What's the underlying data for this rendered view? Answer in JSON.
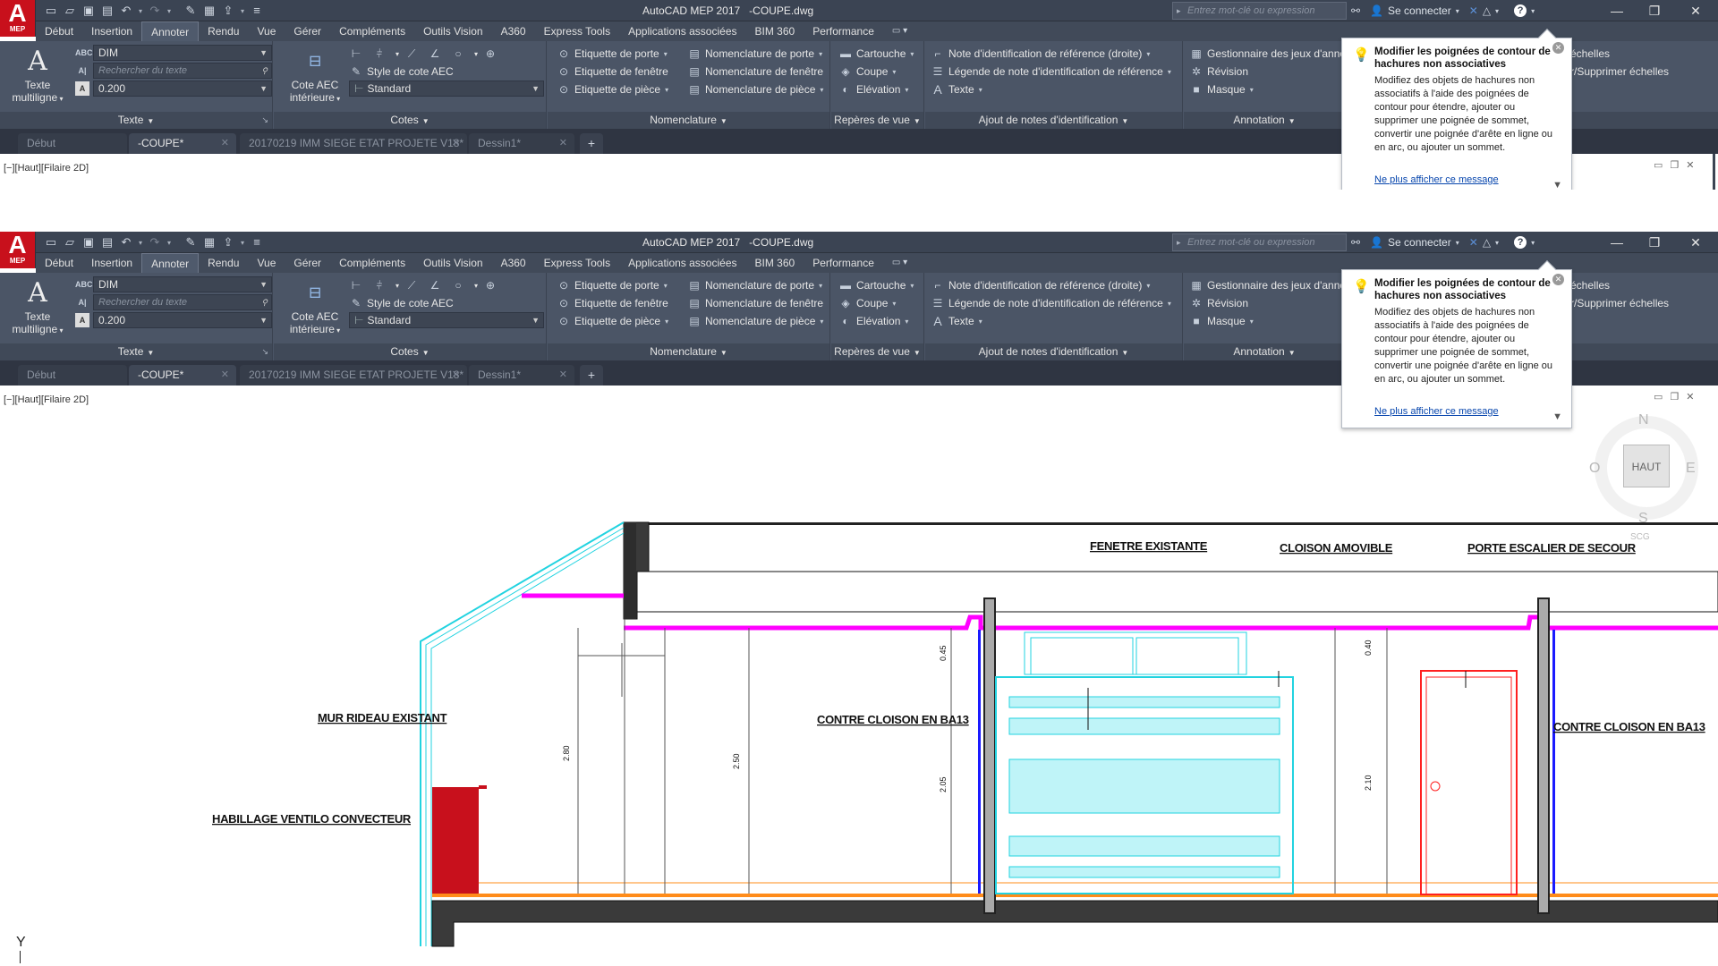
{
  "app": {
    "logo_letter": "A",
    "logo_sub": "MEP",
    "title": "AutoCAD MEP 2017   -COUPE.dwg",
    "search_placeholder": "Entrez mot-clé ou expression",
    "sign_in": "Se connecter"
  },
  "ribbon_tabs": [
    "Début",
    "Insertion",
    "Annoter",
    "Rendu",
    "Vue",
    "Gérer",
    "Compléments",
    "Outils Vision",
    "A360",
    "Express Tools",
    "Applications associées",
    "BIM 360",
    "Performance"
  ],
  "active_ribbon_tab": "Annoter",
  "panels": {
    "texte": {
      "title": "Texte",
      "big_button": [
        "Texte",
        "multiligne"
      ],
      "style_value": "DIM",
      "search_placeholder": "Rechercher du texte",
      "height_value": "0.200"
    },
    "cotes": {
      "title": "Cotes",
      "big_button": [
        "Cote AEC",
        "intérieure"
      ],
      "style_label": "Style de cote AEC",
      "style_value": "Standard"
    },
    "nomenclature": {
      "title": "Nomenclature",
      "items": [
        "Etiquette de porte",
        "Etiquette de fenêtre",
        "Etiquette de pièce",
        "Nomenclature de porte",
        "Nomenclature de fenêtre",
        "Nomenclature de pièce"
      ]
    },
    "reperes": {
      "title": "Repères de vue",
      "items": [
        "Cartouche",
        "Coupe",
        "Elévation"
      ]
    },
    "ajout_notes": {
      "title": "Ajout de notes d'identification",
      "items": [
        "Note d'identification de référence (droite)",
        "Légende de note d'identification de référence",
        "Texte"
      ]
    },
    "annotation": {
      "title": "Annotation",
      "items": [
        "Gestionnaire des jeux d'anno",
        "Révision",
        "Masque"
      ],
      "right_items": [
        "échelles",
        "r/Supprimer échelles"
      ],
      "right_fragment": "n"
    }
  },
  "doc_tabs": [
    "Début",
    "-COUPE*",
    "20170219 IMM SIEGE ETAT PROJETE V18*",
    "Dessin1*"
  ],
  "active_doc_tab": "-COUPE*",
  "viewport_label": "[−][Haut][Filaire 2D]",
  "tooltip": {
    "title": "Modifier les poignées de contour de hachures non associatives",
    "body": "Modifiez des objets de hachures non associatifs à l'aide des poignées de contour pour étendre, ajouter ou supprimer une poignée de sommet, convertir une poignée d'arête en ligne ou en arc, ou ajouter un sommet.",
    "link": "Ne plus afficher ce message"
  },
  "viewcube": {
    "face": "HAUT",
    "north": "N",
    "south": "S",
    "east": "E",
    "west": "O",
    "wcs": "SCG"
  },
  "ucs_label": "Y",
  "drawing": {
    "labels": {
      "fenetre": "FENETRE EXISTANTE",
      "cloison_amovible": "CLOISON AMOVIBLE",
      "porte_escalier": "PORTE ESCALIER DE SECOUR",
      "mur_rideau": "MUR RIDEAU EXISTANT",
      "contre_cloison_1": "CONTRE CLOISON EN BA13",
      "contre_cloison_2": "CONTRE CLOISON EN BA13",
      "habillage": "HABILLAGE VENTILO CONVECTEUR"
    },
    "dims": {
      "h280": "2.80",
      "h250": "2.50",
      "h045": "0.45",
      "h205": "2.05",
      "h040": "0.40",
      "h210": "2.10"
    }
  }
}
